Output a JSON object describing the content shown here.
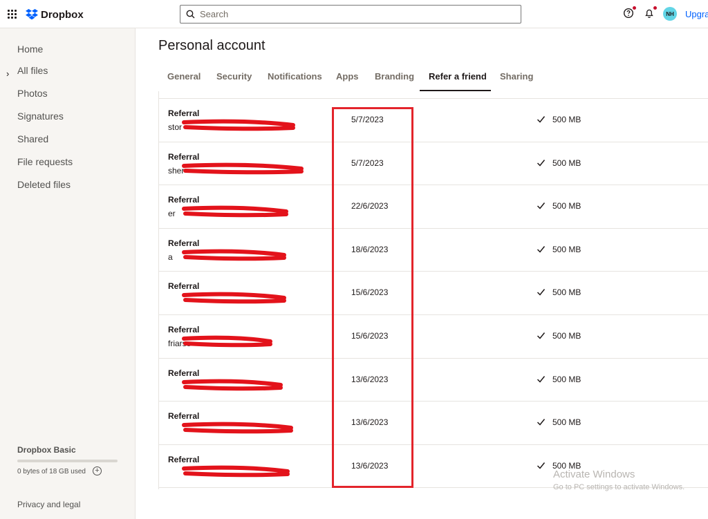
{
  "header": {
    "logo_text": "Dropbox",
    "search_placeholder": "Search",
    "avatar_initials": "NH",
    "upgrade_label": "Upgra"
  },
  "sidebar": {
    "items": [
      {
        "label": "Home"
      },
      {
        "label": "All files"
      },
      {
        "label": "Photos"
      },
      {
        "label": "Signatures"
      },
      {
        "label": "Shared"
      },
      {
        "label": "File requests"
      },
      {
        "label": "Deleted files"
      }
    ],
    "plan": {
      "name": "Dropbox Basic",
      "usage_text": "0 bytes of 18 GB used",
      "usage_fraction": 0.0
    },
    "privacy_label": "Privacy and legal"
  },
  "main": {
    "title": "Personal account",
    "tabs": [
      {
        "label": "General"
      },
      {
        "label": "Security"
      },
      {
        "label": "Notifications"
      },
      {
        "label": "Apps"
      },
      {
        "label": "Branding"
      },
      {
        "label": "Refer a friend",
        "active": true
      },
      {
        "label": "Sharing"
      }
    ],
    "referrals": [
      {
        "title": "Referral",
        "email": "stor",
        "date": "5/7/2023",
        "reward": "500 MB"
      },
      {
        "title": "Referral",
        "email": "sher",
        "date": "5/7/2023",
        "reward": "500 MB"
      },
      {
        "title": "Referral",
        "email": "er",
        "date": "22/6/2023",
        "reward": "500 MB"
      },
      {
        "title": "Referral",
        "email": "a",
        "date": "18/6/2023",
        "reward": "500 MB"
      },
      {
        "title": "Referral",
        "email": "",
        "date": "15/6/2023",
        "reward": "500 MB"
      },
      {
        "title": "Referral",
        "email": "friarse",
        "date": "15/6/2023",
        "reward": "500 MB"
      },
      {
        "title": "Referral",
        "email": "",
        "date": "13/6/2023",
        "reward": "500 MB"
      },
      {
        "title": "Referral",
        "email": "",
        "date": "13/6/2023",
        "reward": "500 MB"
      },
      {
        "title": "Referral",
        "email": "",
        "date": "13/6/2023",
        "reward": "500 MB"
      }
    ]
  },
  "watermark": {
    "title": "Activate Windows",
    "subtitle": "Go to PC settings to activate Windows."
  },
  "colors": {
    "accent": "#0061fe",
    "highlight": "#e3242b",
    "avatar_bg": "#62d5e6",
    "notification_dot": "#c8102e"
  }
}
